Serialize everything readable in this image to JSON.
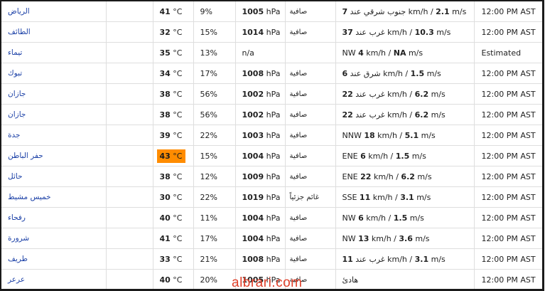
{
  "units": {
    "temp": " °C",
    "pressure": " hPa",
    "speed_kmh": " km/h / ",
    "speed_ms": " m/s"
  },
  "watermark": "albrari.com",
  "colors": {
    "hot_highlight": "#ff8c00",
    "city_link": "#1a3fa6",
    "watermark": "#e0402a"
  },
  "rows": [
    {
      "city": "الرياض",
      "temp": "41",
      "humidity": "9%",
      "pressure": "1005",
      "condition": "صافية",
      "wind_dir": "جنوب شرقي عند ",
      "wind_kmh": "7",
      "wind_ms": "2.1",
      "time": "12:00 PM AST"
    },
    {
      "city": "الطائف",
      "temp": "32",
      "humidity": "15%",
      "pressure": "1014",
      "condition": "صافية",
      "wind_dir": "غرب عند ",
      "wind_kmh": "37",
      "wind_ms": "10.3",
      "time": "12:00 PM AST"
    },
    {
      "city": "تيماء",
      "temp": "35",
      "humidity": "13%",
      "pressure_text": "n/a",
      "condition": "",
      "wind_dir": "NW ",
      "wind_kmh": "4",
      "wind_ms": "NA",
      "time": "Estimated"
    },
    {
      "city": "تبوك",
      "temp": "34",
      "humidity": "17%",
      "pressure": "1008",
      "condition": "صافية",
      "wind_dir": "شرق عند ",
      "wind_kmh": "6",
      "wind_ms": "1.5",
      "time": "12:00 PM AST"
    },
    {
      "city": "جازان",
      "temp": "38",
      "humidity": "56%",
      "pressure": "1002",
      "condition": "صافية",
      "wind_dir": "غرب عند ",
      "wind_kmh": "22",
      "wind_ms": "6.2",
      "time": "12:00 PM AST"
    },
    {
      "city": "جازان",
      "temp": "38",
      "humidity": "56%",
      "pressure": "1002",
      "condition": "صافية",
      "wind_dir": "غرب عند ",
      "wind_kmh": "22",
      "wind_ms": "6.2",
      "time": "12:00 PM AST"
    },
    {
      "city": "جدة",
      "temp": "39",
      "humidity": "22%",
      "pressure": "1003",
      "condition": "صافية",
      "wind_dir": "NNW ",
      "wind_kmh": "18",
      "wind_ms": "5.1",
      "time": "12:00 PM AST"
    },
    {
      "city": "حفر الباطن",
      "temp": "43",
      "hot": true,
      "humidity": "15%",
      "pressure": "1004",
      "condition": "صافية",
      "wind_dir": "ENE ",
      "wind_kmh": "6",
      "wind_ms": "1.5",
      "time": "12:00 PM AST"
    },
    {
      "city": "حائل",
      "temp": "38",
      "humidity": "12%",
      "pressure": "1009",
      "condition": "صافية",
      "wind_dir": "ENE ",
      "wind_kmh": "22",
      "wind_ms": "6.2",
      "time": "12:00 PM AST"
    },
    {
      "city": "خميس مشيط",
      "temp": "30",
      "humidity": "22%",
      "pressure": "1019",
      "condition": "غائم جزئياً",
      "wind_dir": "SSE ",
      "wind_kmh": "11",
      "wind_ms": "3.1",
      "time": "12:00 PM AST"
    },
    {
      "city": "رفحاء",
      "temp": "40",
      "humidity": "11%",
      "pressure": "1004",
      "condition": "صافية",
      "wind_dir": "NW ",
      "wind_kmh": "6",
      "wind_ms": "1.5",
      "time": "12:00 PM AST"
    },
    {
      "city": "شرورة",
      "temp": "41",
      "humidity": "17%",
      "pressure": "1004",
      "condition": "صافية",
      "wind_dir": "NW ",
      "wind_kmh": "13",
      "wind_ms": "3.6",
      "time": "12:00 PM AST"
    },
    {
      "city": "طريف",
      "temp": "33",
      "humidity": "21%",
      "pressure": "1008",
      "condition": "صافية",
      "wind_dir": "غرب عند ",
      "wind_kmh": "11",
      "wind_ms": "3.1",
      "time": "12:00 PM AST"
    },
    {
      "city": "عرعر",
      "temp": "40",
      "humidity": "20%",
      "pressure": "1005",
      "condition": "صافية",
      "wind_text": "هادئ",
      "time": "12:00 PM AST"
    }
  ]
}
